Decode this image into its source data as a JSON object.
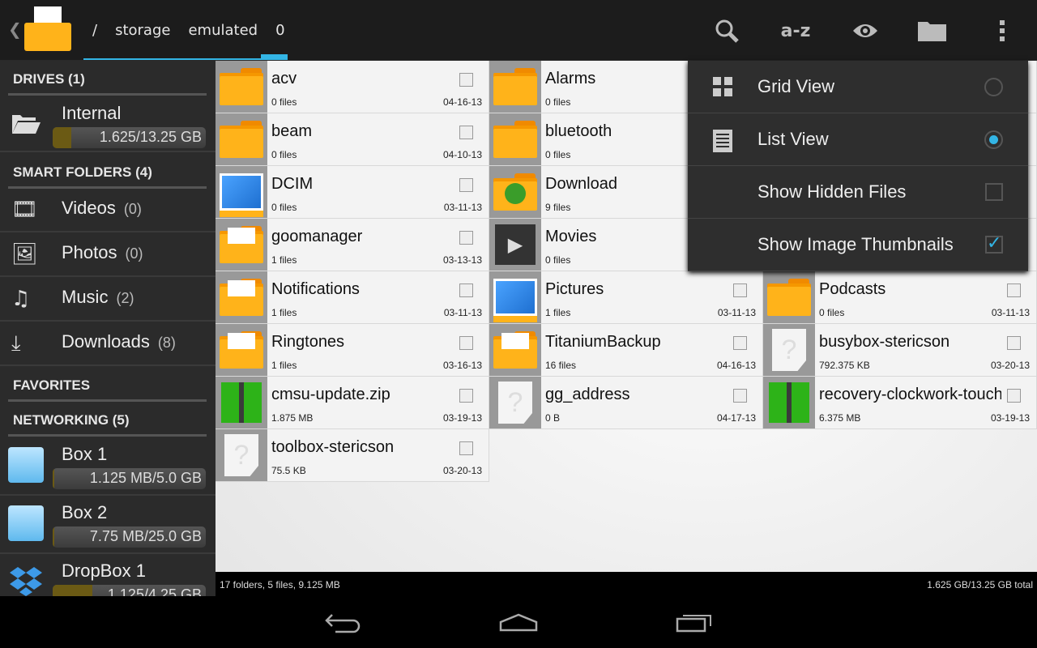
{
  "breadcrumbs": [
    "/",
    "storage",
    "emulated",
    "0"
  ],
  "toolbar": {
    "sort_label": "a-z",
    "icons": [
      "search-icon",
      "sort-az-icon",
      "eye-icon",
      "folder-icon",
      "overflow-menu-icon"
    ]
  },
  "sidebar": {
    "drives_header": "DRIVES (1)",
    "internal": {
      "label": "Internal",
      "usage": "1.625/13.25 GB",
      "fill": 0.12
    },
    "smart_header": "SMART FOLDERS (4)",
    "smart": [
      {
        "label": "Videos",
        "count": "(0)"
      },
      {
        "label": "Photos",
        "count": "(0)"
      },
      {
        "label": "Music",
        "count": "(2)"
      },
      {
        "label": "Downloads",
        "count": "(8)"
      }
    ],
    "favorites_header": "FAVORITES",
    "networking_header": "NETWORKING (5)",
    "networking": [
      {
        "label": "Box 1",
        "usage": "1.125 MB/5.0 GB",
        "fill": 0.01
      },
      {
        "label": "Box 2",
        "usage": "7.75 MB/25.0 GB",
        "fill": 0.01
      },
      {
        "label": "DropBox 1",
        "usage": "1.125/4.25 GB",
        "fill": 0.26
      }
    ]
  },
  "files": [
    {
      "name": "acv",
      "info": "0 files",
      "date": "04-16-13",
      "type": "folder"
    },
    {
      "name": "Alarms",
      "info": "0 files",
      "date": "",
      "type": "folder"
    },
    null,
    {
      "name": "beam",
      "info": "0 files",
      "date": "04-10-13",
      "type": "folder"
    },
    {
      "name": "bluetooth",
      "info": "0 files",
      "date": "",
      "type": "folder"
    },
    null,
    {
      "name": "DCIM",
      "info": "0 files",
      "date": "03-11-13",
      "type": "pictures"
    },
    {
      "name": "Download",
      "info": "9 files",
      "date": "",
      "type": "download"
    },
    null,
    {
      "name": "goomanager",
      "info": "1 files",
      "date": "03-13-13",
      "type": "docfolder"
    },
    {
      "name": "Movies",
      "info": "0 files",
      "date": "",
      "type": "movies"
    },
    null,
    {
      "name": "Notifications",
      "info": "1 files",
      "date": "03-11-13",
      "type": "docfolder"
    },
    {
      "name": "Pictures",
      "info": "1 files",
      "date": "03-11-13",
      "type": "pictures"
    },
    {
      "name": "Podcasts",
      "info": "0 files",
      "date": "03-11-13",
      "type": "folder"
    },
    {
      "name": "Ringtones",
      "info": "1 files",
      "date": "03-16-13",
      "type": "docfolder"
    },
    {
      "name": "TitaniumBackup",
      "info": "16 files",
      "date": "04-16-13",
      "type": "docfolder"
    },
    {
      "name": "busybox-stericson",
      "info": "792.375 KB",
      "date": "03-20-13",
      "type": "file"
    },
    {
      "name": "cmsu-update.zip",
      "info": "1.875 MB",
      "date": "03-19-13",
      "type": "zip"
    },
    {
      "name": "gg_address",
      "info": "0 B",
      "date": "04-17-13",
      "type": "file"
    },
    {
      "name": "recovery-clockwork-touch",
      "info": "6.375 MB",
      "date": "03-19-13",
      "type": "zip"
    },
    {
      "name": "toolbox-stericson",
      "info": "75.5 KB",
      "date": "03-20-13",
      "type": "file"
    }
  ],
  "menu": [
    {
      "label": "Grid View",
      "control": "radio",
      "checked": false
    },
    {
      "label": "List View",
      "control": "radio",
      "checked": true
    },
    {
      "label": "Show Hidden Files",
      "control": "checkbox",
      "checked": false
    },
    {
      "label": "Show Image Thumbnails",
      "control": "checkbox",
      "checked": true
    }
  ],
  "status": {
    "left": "17 folders, 5 files, 9.125 MB",
    "right": "1.625 GB/13.25 GB total"
  },
  "colors": {
    "accent": "#33b5e5",
    "folder": "#ffb31a"
  }
}
